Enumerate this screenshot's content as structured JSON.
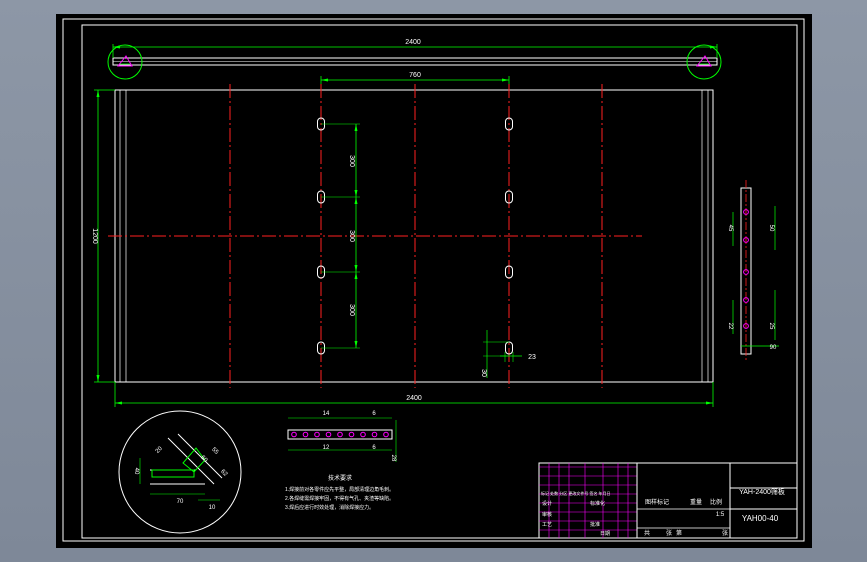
{
  "colors": {
    "viewport_bg": "#000000",
    "border": "#ffffff",
    "geometry": "#ffffff",
    "centerline": "#ff2020",
    "dimension": "#00ff00",
    "hole": "#ff00ff",
    "title_grid": "#ff00ff",
    "text": "#ffffff"
  },
  "dimensions": {
    "overall_length_top": "2400",
    "hole_spacing": "760",
    "height": "1200",
    "overall_length_bottom": "2400",
    "slot_pitch_1": "300",
    "slot_pitch_2": "300",
    "slot_pitch_3": "300",
    "slot_width": "23",
    "slot_height": "30",
    "side_45": "45",
    "side_50": "50",
    "side_22": "22",
    "side_25": "25",
    "side_90": "90",
    "strip_14": "14",
    "strip_6a": "6",
    "strip_12": "12",
    "strip_6b": "6",
    "strip_28": "28",
    "detail_70": "70",
    "detail_40": "40",
    "detail_20": "20",
    "detail_55": "55",
    "detail_60": "60",
    "detail_62": "62",
    "detail_10": "10"
  },
  "notes": {
    "title": "技术要求",
    "lines": [
      "1.焊接前对各零件应先平整，局部清理边角毛刺。",
      "2.各焊缝需焊接牢固，不得有气孔、夹渣等缺陷。",
      "3.焊后应进行时效处理，消除焊接应力。"
    ]
  },
  "title_block": {
    "part_name": "YAH-2400筛板",
    "drawing_no": "YAH00-40",
    "scale": "1:5",
    "label_mark": "图样标记",
    "label_weight": "重量",
    "label_scale": "比例",
    "label_sheets": "共",
    "label_sheet": "第",
    "label_zhang": "张",
    "label_zhang2": "张",
    "label_design": "设计",
    "label_check": "审核",
    "label_process": "工艺",
    "label_date": "日期",
    "label_revision": "标记 处数 分区 更改文件号 签名 年月日",
    "label_std": "标准化",
    "label_approve": "批准"
  }
}
